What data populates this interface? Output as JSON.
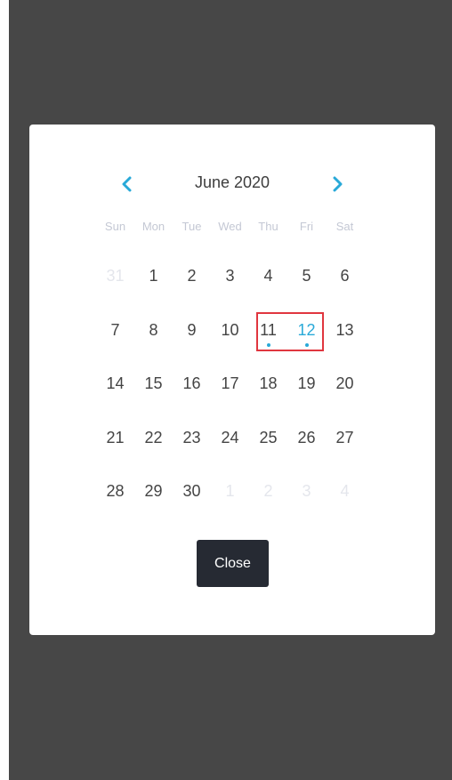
{
  "calendar": {
    "month_title": "June 2020",
    "prev_icon": "chevron-left-icon",
    "next_icon": "chevron-right-icon",
    "weekdays": [
      "Sun",
      "Mon",
      "Tue",
      "Wed",
      "Thu",
      "Fri",
      "Sat"
    ],
    "weeks": [
      [
        {
          "label": "31",
          "muted": true
        },
        {
          "label": "1"
        },
        {
          "label": "2"
        },
        {
          "label": "3"
        },
        {
          "label": "4"
        },
        {
          "label": "5"
        },
        {
          "label": "6"
        }
      ],
      [
        {
          "label": "7"
        },
        {
          "label": "8"
        },
        {
          "label": "9"
        },
        {
          "label": "10"
        },
        {
          "label": "11",
          "dot": true,
          "selected": true
        },
        {
          "label": "12",
          "dot": true,
          "accent": true,
          "selected": true
        },
        {
          "label": "13"
        }
      ],
      [
        {
          "label": "14"
        },
        {
          "label": "15"
        },
        {
          "label": "16"
        },
        {
          "label": "17"
        },
        {
          "label": "18"
        },
        {
          "label": "19"
        },
        {
          "label": "20"
        }
      ],
      [
        {
          "label": "21"
        },
        {
          "label": "22"
        },
        {
          "label": "23"
        },
        {
          "label": "24"
        },
        {
          "label": "25"
        },
        {
          "label": "26"
        },
        {
          "label": "27"
        }
      ],
      [
        {
          "label": "28"
        },
        {
          "label": "29"
        },
        {
          "label": "30"
        },
        {
          "label": "1",
          "muted": true
        },
        {
          "label": "2",
          "muted": true
        },
        {
          "label": "3",
          "muted": true
        },
        {
          "label": "4",
          "muted": true
        }
      ]
    ]
  },
  "close_label": "Close",
  "colors": {
    "accent": "#29a9d8",
    "highlight_border": "#e0363f",
    "button_bg": "#262a33",
    "overlay": "#474747"
  }
}
